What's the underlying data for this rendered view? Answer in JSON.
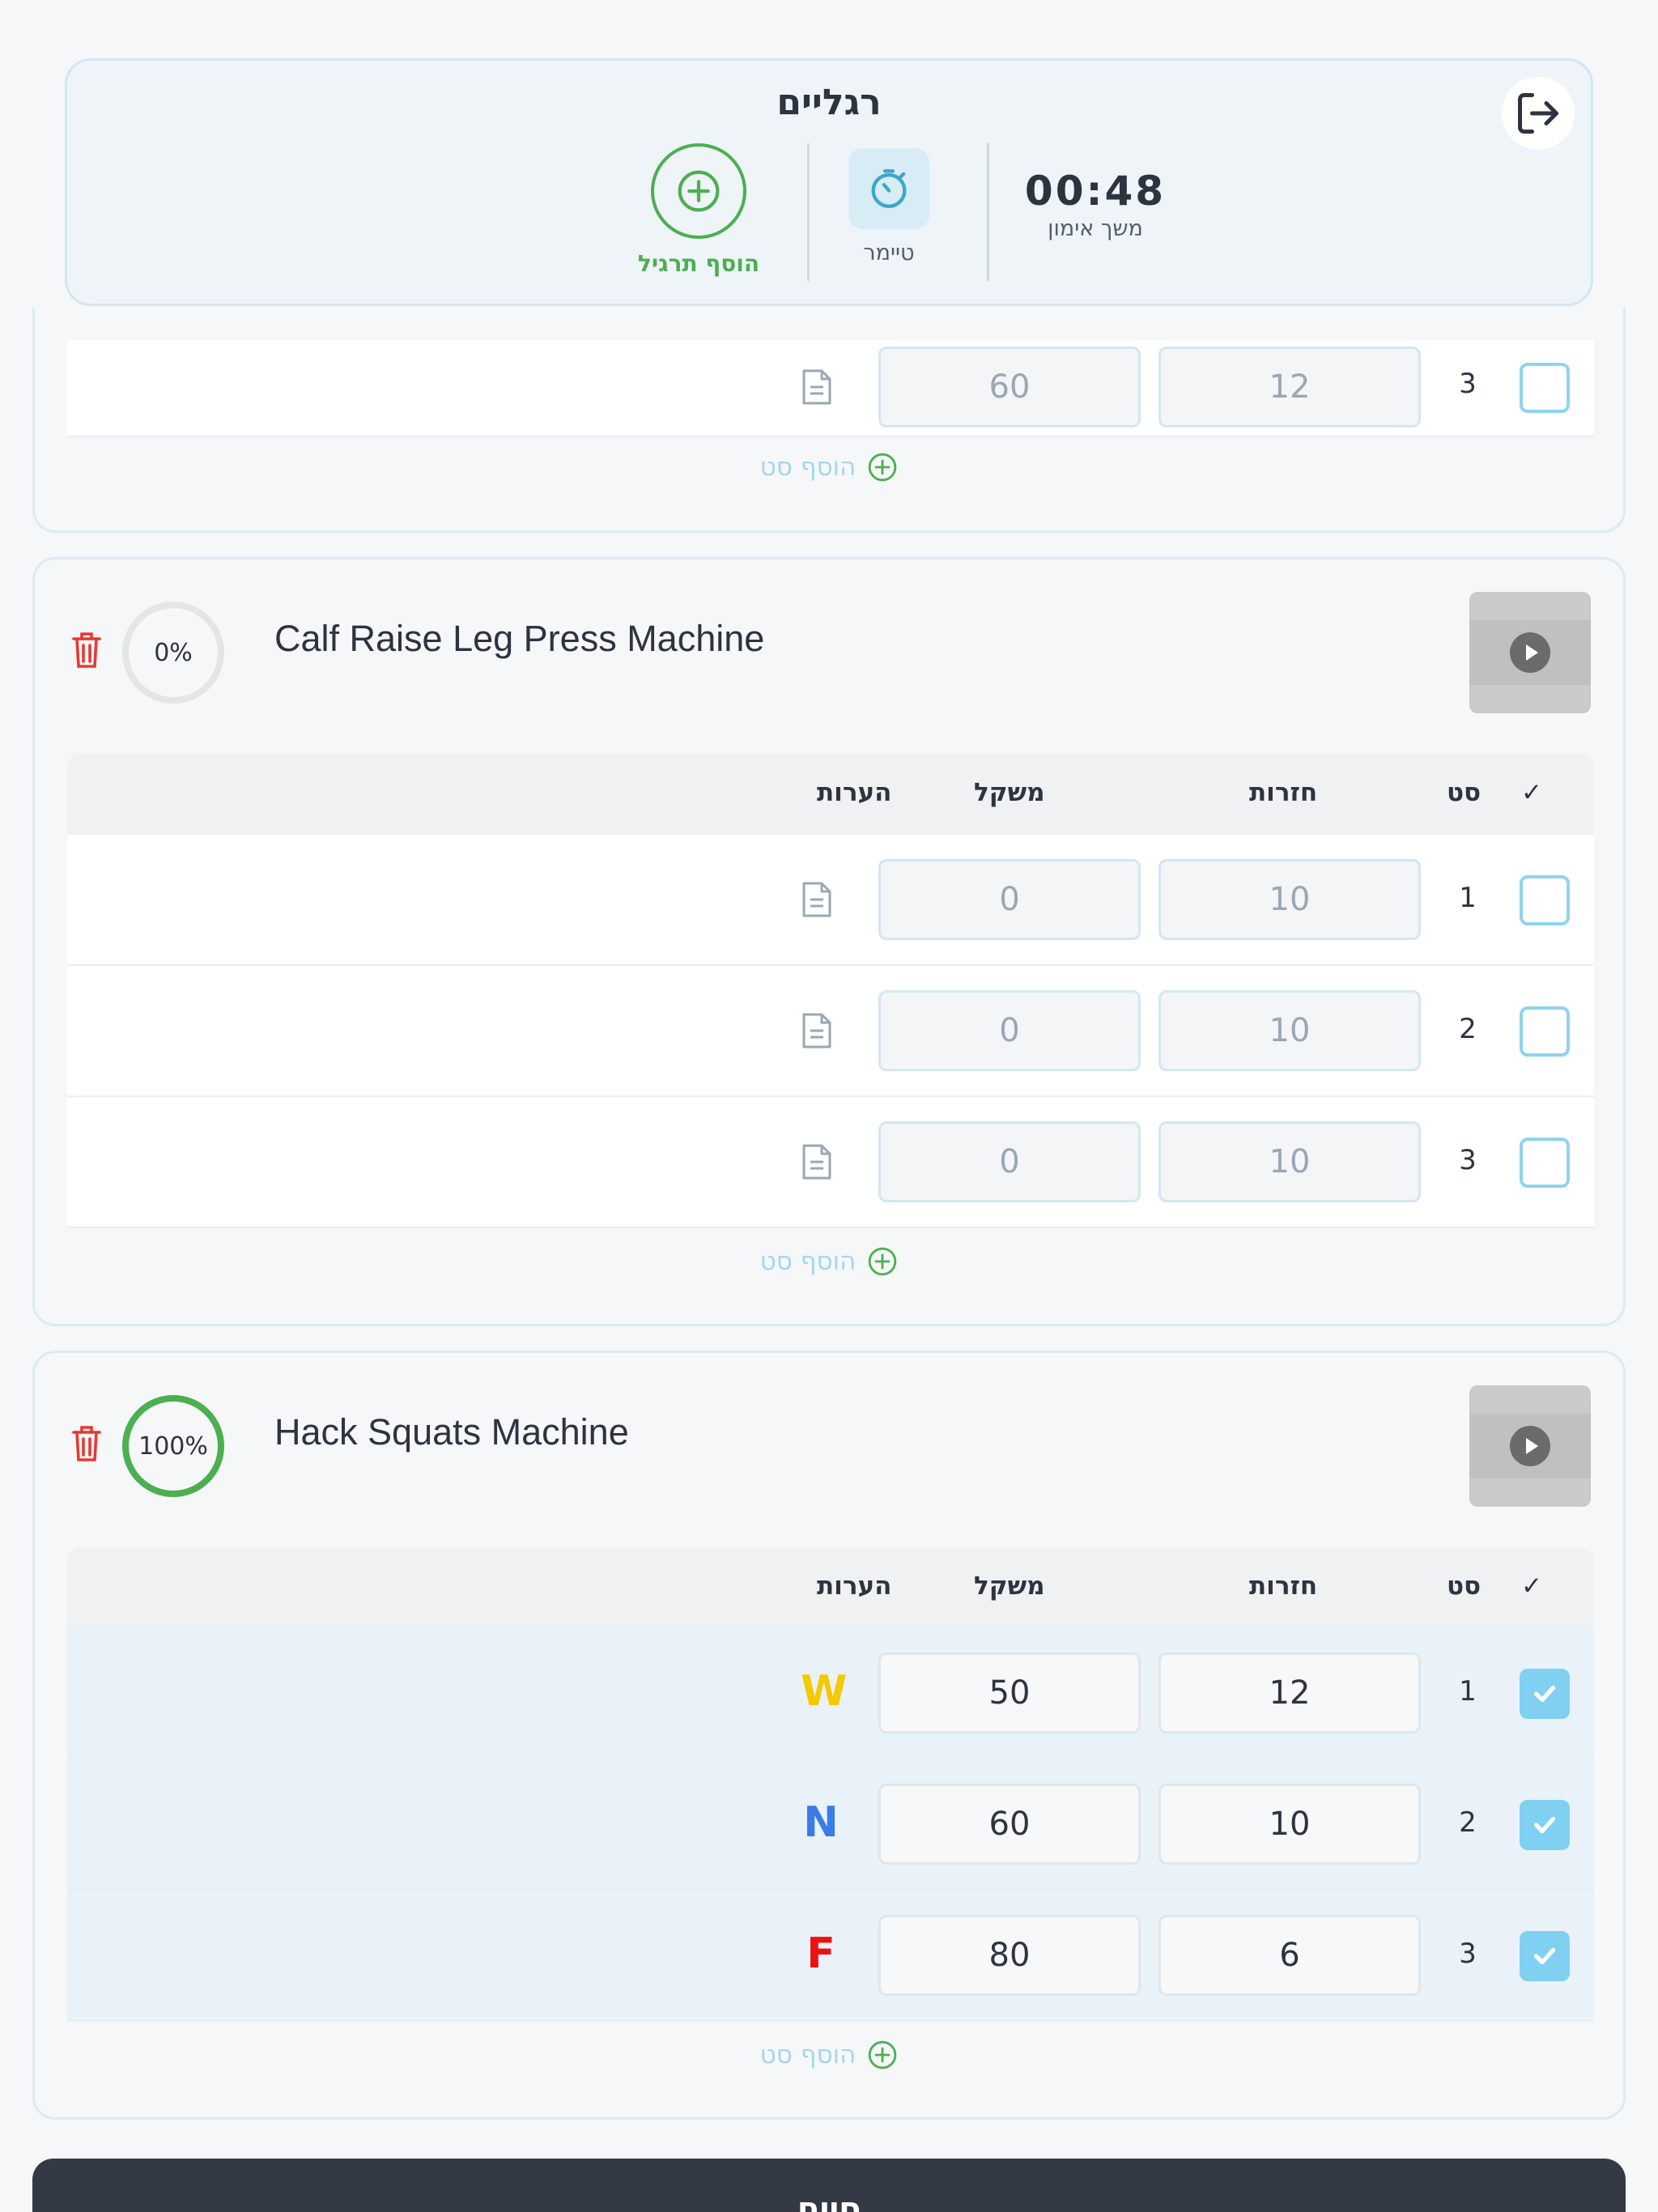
{
  "header": {
    "title": "רגליים",
    "add_exercise_label": "הוסף תרגיל",
    "timer_label": "טיימר",
    "duration_value": "00:48",
    "duration_label": "משך אימון"
  },
  "columns": {
    "check": "✓",
    "set": "סט",
    "reps": "חזרות",
    "weight": "משקל",
    "notes": "הערות"
  },
  "add_set_label": "הוסף סט",
  "partial_exercise": {
    "row": {
      "set": "3",
      "reps": "12",
      "weight": "60"
    }
  },
  "exercises": [
    {
      "name": "Calf Raise Leg Press Machine",
      "progress": "0%",
      "rows": [
        {
          "set": "1",
          "reps": "10",
          "weight": "0",
          "done": false
        },
        {
          "set": "2",
          "reps": "10",
          "weight": "0",
          "done": false
        },
        {
          "set": "3",
          "reps": "10",
          "weight": "0",
          "done": false
        }
      ]
    },
    {
      "name": "Hack Squats Machine",
      "progress": "100%",
      "rows": [
        {
          "set": "1",
          "reps": "12",
          "weight": "50",
          "done": true,
          "note": "W",
          "note_color": "#f5c800"
        },
        {
          "set": "2",
          "reps": "10",
          "weight": "60",
          "done": true,
          "note": "N",
          "note_color": "#3b7be8"
        },
        {
          "set": "3",
          "reps": "6",
          "weight": "80",
          "done": true,
          "note": "F",
          "note_color": "#ee1111"
        }
      ]
    }
  ],
  "finish_label": "סיים",
  "colors": {
    "accent_green": "#4caf50",
    "checkbox": "#7fd0f1",
    "trash": "#e53935",
    "finish": "#343a45"
  }
}
